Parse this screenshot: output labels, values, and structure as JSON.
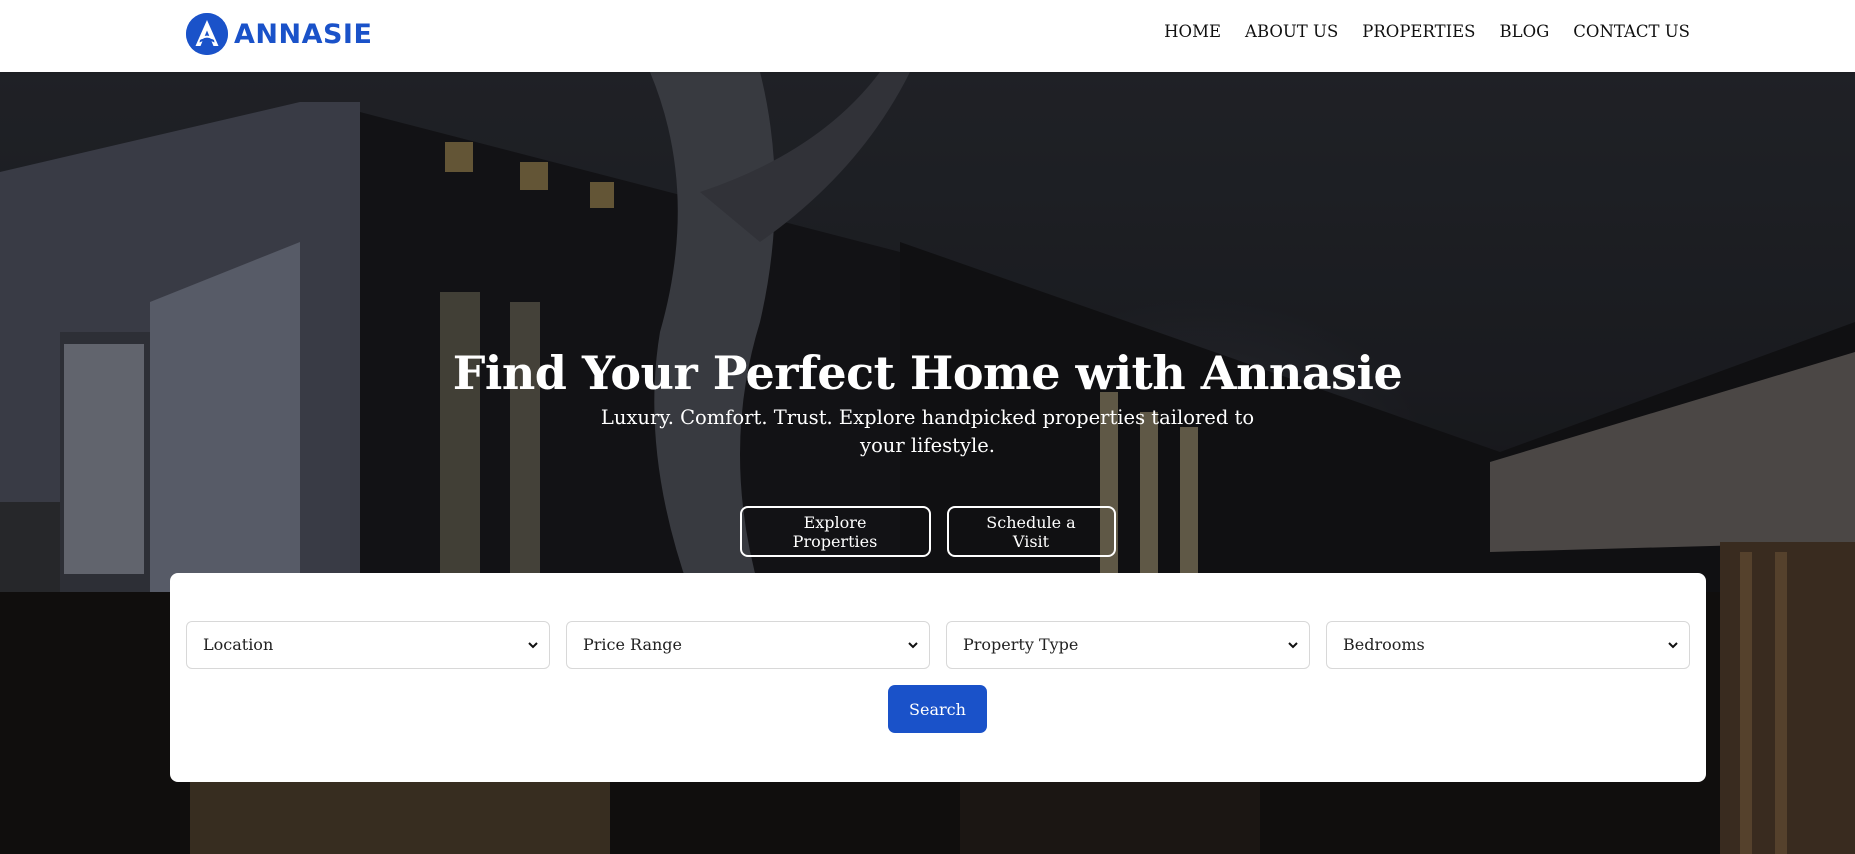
{
  "brand": {
    "name": "ANNASIE",
    "color": "#1a52c9"
  },
  "nav": {
    "items": [
      "HOME",
      "ABOUT US",
      "PROPERTIES",
      "BLOG",
      "CONTACT US"
    ]
  },
  "hero": {
    "title": "Find Your Perfect Home with Annasie",
    "subtitle": "Luxury. Comfort. Trust. Explore handpicked properties tailored to your lifestyle.",
    "buttons": {
      "explore": "Explore Properties",
      "schedule": "Schedule a Visit"
    }
  },
  "search": {
    "filters": {
      "location": "Location",
      "price": "Price Range",
      "type": "Property Type",
      "bedrooms": "Bedrooms"
    },
    "button": "Search"
  },
  "icons": {
    "logo": "annasie-logo-icon",
    "dropdown": "chevron-down-icon"
  }
}
